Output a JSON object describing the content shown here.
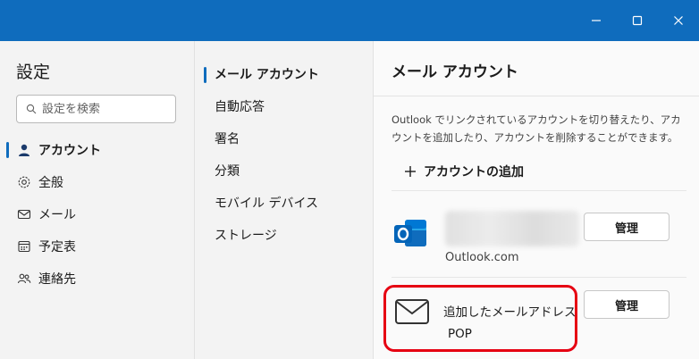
{
  "window": {
    "controls": [
      "minimize-icon",
      "maximize-icon",
      "close-icon"
    ],
    "accent": "#0f6cbd"
  },
  "settings": {
    "title": "設定",
    "search_placeholder": "設定を検索",
    "nav": [
      {
        "label": "アカウント",
        "icon": "person-icon",
        "active": true
      },
      {
        "label": "全般",
        "icon": "gear-icon",
        "active": false
      },
      {
        "label": "メール",
        "icon": "mail-icon",
        "active": false
      },
      {
        "label": "予定表",
        "icon": "calendar-icon",
        "active": false
      },
      {
        "label": "連絡先",
        "icon": "people-icon",
        "active": false
      }
    ]
  },
  "submenu": [
    {
      "label": "メール アカウント",
      "active": true
    },
    {
      "label": "自動応答",
      "active": false
    },
    {
      "label": "署名",
      "active": false
    },
    {
      "label": "分類",
      "active": false
    },
    {
      "label": "モバイル デバイス",
      "active": false
    },
    {
      "label": "ストレージ",
      "active": false
    }
  ],
  "panel": {
    "title": "メール アカウント",
    "description": "Outlook でリンクされているアカウントを切り替えたり、アカウントを追加したり、アカウントを削除することができます。",
    "add_account": "アカウントの追加",
    "accounts": [
      {
        "type": "Outlook.com",
        "icon": "outlook-icon",
        "manage": "管理",
        "name_blurred": true
      },
      {
        "name": "追加したメールアドレス",
        "type": "POP",
        "icon": "envelope-icon",
        "manage": "管理",
        "highlighted": true
      }
    ],
    "highlight_color": "#e60012"
  }
}
